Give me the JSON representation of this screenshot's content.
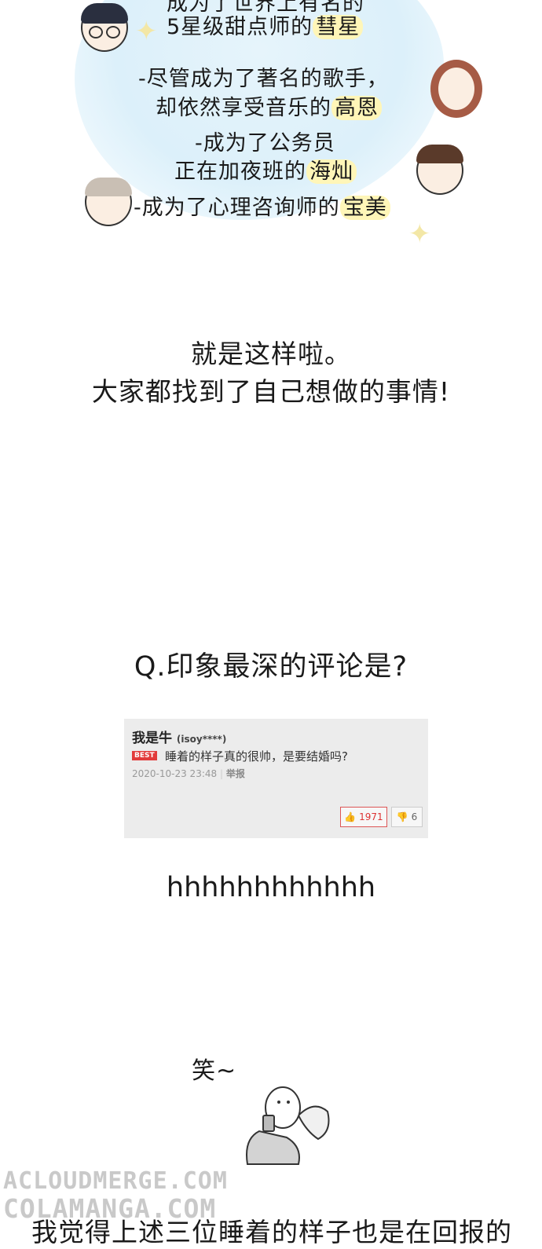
{
  "top_panel": {
    "line0": "成为了世界上有名的",
    "line1_pre": "5星级甜点师的",
    "line1_name": "彗星",
    "line2": "-尽管成为了著名的歌手，",
    "line3_pre": "却依然享受音乐的",
    "line3_name": "高恩",
    "line4": "-成为了公务员",
    "line5_pre": "正在加夜班的",
    "line5_name": "海灿",
    "line6_pre": "-成为了心理咨询师的",
    "line6_name": "宝美"
  },
  "narration": {
    "line1": "就是这样啦。",
    "line2": "大家都找到了自己想做的事情!"
  },
  "question": "Q.印象最深的评论是?",
  "comment": {
    "username": "我是牛",
    "user_id": "(isoy****)",
    "badge": "BEST",
    "text": "睡着的样子真的很帅，是要结婚吗?",
    "timestamp": "2020-10-23 23:48",
    "report": "举报",
    "likes": "1971",
    "dislikes": "6"
  },
  "reaction": "hhhhhhhhhhhh",
  "doodle_caption": "笑~",
  "bottom_text": "我觉得上述三位睡着的样子也是在回报的",
  "watermark": {
    "line1": "ACLOUDMERGE.COM",
    "line2": "COLAMANGA.COM"
  },
  "colors": {
    "highlight": "#fff6b8",
    "bubble": "#dcf0fa",
    "best_badge": "#e23b3b"
  }
}
